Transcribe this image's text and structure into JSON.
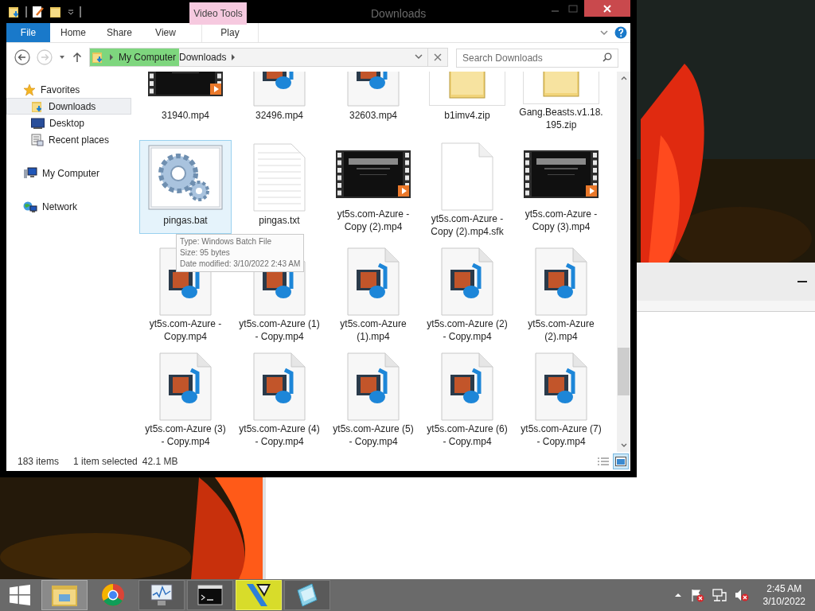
{
  "window": {
    "title": "Downloads",
    "context_group": "Video Tools"
  },
  "ribbon": {
    "tabs": [
      {
        "label": "File",
        "kind": "file"
      },
      {
        "label": "Home",
        "kind": "tab"
      },
      {
        "label": "Share",
        "kind": "tab"
      },
      {
        "label": "View",
        "kind": "tab"
      },
      {
        "label": "Play",
        "kind": "context"
      }
    ]
  },
  "address": {
    "crumbs": [
      {
        "label": "My Computer",
        "hovered": true
      },
      {
        "label": "Downloads",
        "hovered": false
      }
    ]
  },
  "search": {
    "placeholder": "Search Downloads"
  },
  "sidebar": {
    "items": [
      {
        "label": "Favorites",
        "kind": "star",
        "selected": false,
        "children": [
          {
            "label": "Downloads",
            "kind": "downloads",
            "selected": true
          },
          {
            "label": "Desktop",
            "kind": "desktop",
            "selected": false
          },
          {
            "label": "Recent places",
            "kind": "recent",
            "selected": false
          }
        ]
      },
      {
        "label": "My Computer",
        "kind": "computer",
        "selected": false
      },
      {
        "label": "Network",
        "kind": "network",
        "selected": false
      }
    ]
  },
  "files": [
    {
      "name": "31940.mp4",
      "kind": "video",
      "selected": false
    },
    {
      "name": "32496.mp4",
      "kind": "media",
      "selected": false
    },
    {
      "name": "32603.mp4",
      "kind": "media",
      "selected": false
    },
    {
      "name": "b1imv4.zip",
      "kind": "zip",
      "selected": false
    },
    {
      "name": "Gang.Beasts.v1.18.195.zip",
      "kind": "zip",
      "selected": false
    },
    {
      "name": "pingas.bat",
      "kind": "batch",
      "selected": true
    },
    {
      "name": "pingas.txt",
      "kind": "text",
      "selected": false
    },
    {
      "name": "yt5s.com-Azure - Copy (2).mp4",
      "kind": "video",
      "selected": false
    },
    {
      "name": "yt5s.com-Azure - Copy (2).mp4.sfk",
      "kind": "blank",
      "selected": false
    },
    {
      "name": "yt5s.com-Azure - Copy (3).mp4",
      "kind": "video",
      "selected": false
    },
    {
      "name": "yt5s.com-Azure - Copy.mp4",
      "kind": "media",
      "selected": false
    },
    {
      "name": "yt5s.com-Azure (1) - Copy.mp4",
      "kind": "media",
      "selected": false
    },
    {
      "name": "yt5s.com-Azure (1).mp4",
      "kind": "media",
      "selected": false
    },
    {
      "name": "yt5s.com-Azure (2) - Copy.mp4",
      "kind": "media",
      "selected": false
    },
    {
      "name": "yt5s.com-Azure (2).mp4",
      "kind": "media",
      "selected": false
    },
    {
      "name": "yt5s.com-Azure (3) - Copy.mp4",
      "kind": "media",
      "selected": false
    },
    {
      "name": "yt5s.com-Azure (4) - Copy.mp4",
      "kind": "media",
      "selected": false
    },
    {
      "name": "yt5s.com-Azure (5) - Copy.mp4",
      "kind": "media",
      "selected": false
    },
    {
      "name": "yt5s.com-Azure (6) - Copy.mp4",
      "kind": "media",
      "selected": false
    },
    {
      "name": "yt5s.com-Azure (7) - Copy.mp4",
      "kind": "media",
      "selected": false
    }
  ],
  "tooltip": {
    "lines": [
      "Type: Windows Batch File",
      "Size: 95 bytes",
      "Date modified: 3/10/2022 2:43 AM"
    ]
  },
  "status_bar": {
    "count": "183 items",
    "selection": "1 item selected",
    "size": "42.1 MB",
    "views": [
      {
        "kind": "details",
        "selected": false
      },
      {
        "kind": "large-icons",
        "selected": true
      }
    ]
  },
  "taskbar": {
    "apps": [
      {
        "kind": "explorer",
        "active": true
      },
      {
        "kind": "chrome",
        "active": false
      },
      {
        "kind": "monitor",
        "active": false
      },
      {
        "kind": "terminal",
        "active": false
      },
      {
        "kind": "editor",
        "active": true
      },
      {
        "kind": "notepad",
        "active": false
      }
    ],
    "clock": {
      "time": "2:45 AM",
      "date": "3/10/2022"
    }
  }
}
